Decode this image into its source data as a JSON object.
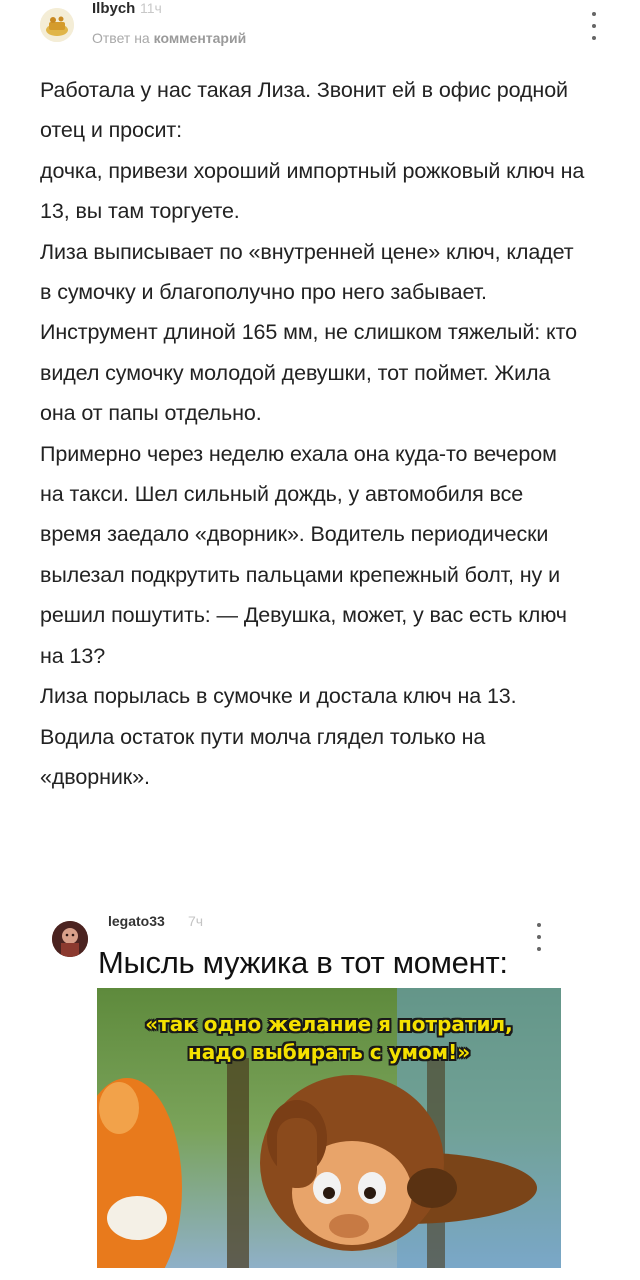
{
  "comment": {
    "author": "Ilbych",
    "time": "11ч",
    "reply_prefix": "Ответ на",
    "reply_target": "комментарий",
    "paragraphs": [
      "Работала у нас такая Лиза. Звонит ей в офис родной отец и просит:",
      "дочка, привези хороший импортный рожковый ключ на 13, вы там торгуете.",
      "Лиза выписывает по «внутренней цене» ключ, кладет в сумочку и благополучно про него забывает.",
      "Инструмент длиной 165 мм, не слишком тяжелый: кто видел сумочку молодой девушки, тот поймет. Жила она от папы отдельно.",
      "Примерно через неделю ехала она куда-то вечером на такси. Шел сильный дождь, у автомобиля все время заедало «дворник». Водитель периодически вылезал подкрутить пальцами крепежный болт, ну и решил пошутить: — Девушка, может, у вас есть ключ на 13?",
      "Лиза порылась в сумочке и достала ключ на 13.",
      "Водила остаток пути молча глядел только на «дворник»."
    ]
  },
  "reply": {
    "author": "legato33",
    "time": "7ч",
    "text": "Мысль мужика в тот момент:",
    "meme_caption_line1": "«так одно желание я потратил,",
    "meme_caption_line2": "надо выбирать с умом!»"
  },
  "icons": {
    "menu": "more-vertical-icon",
    "avatar1": "avatar-image",
    "avatar2": "avatar-image"
  },
  "colors": {
    "caption_fill": "#f5e100",
    "caption_stroke": "#1a1a1a",
    "muted_text": "#a8a8a8"
  }
}
